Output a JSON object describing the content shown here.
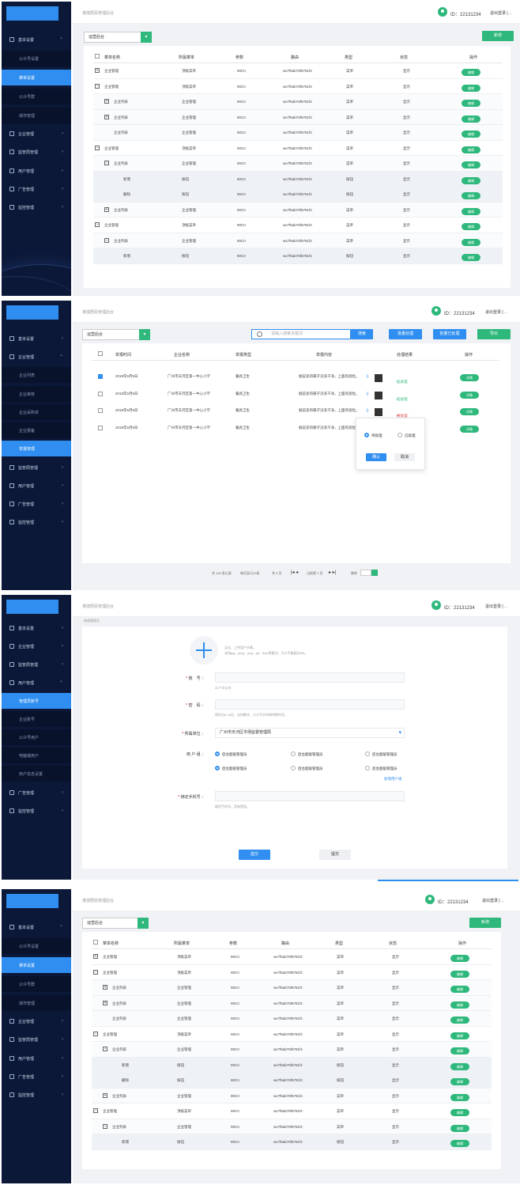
{
  "common": {
    "app_title": "港澳居民管理后台",
    "user_id": "ID：22131234",
    "logout": "退出登录",
    "logout_icon": "logout-icon"
  },
  "menu_list": {
    "sidebar": {
      "basic_settings": "基本设置",
      "sub": [
        "公众号设置",
        "菜单设置",
        "公众号群",
        "城市管理"
      ],
      "enterprise": "企业管理",
      "supervision": "监管局管理",
      "users": "用户管理",
      "ads": "广告管理",
      "monitoring": "监控管理"
    },
    "select_value": "运营后台",
    "add_button": "新增",
    "headers": [
      "菜单名称",
      "所属菜单",
      "参数",
      "路由",
      "类型",
      "状态",
      "操作"
    ],
    "rows": [
      {
        "name": "企业管理",
        "parent": "顶级菜单",
        "param": "90CII",
        "route": "wx7f6ab76f6781f4",
        "type": "菜单",
        "status": "显示",
        "op": "编辑",
        "toggle": "+"
      },
      {
        "name": "企业管理",
        "parent": "顶级菜单",
        "param": "90CII",
        "route": "wx7f6ab76f6781f4",
        "type": "菜单",
        "status": "显示",
        "op": "编辑",
        "toggle": "−"
      },
      {
        "name": "企业列表",
        "parent": "企业管理",
        "param": "90CII",
        "route": "wx7f6ab76f6781f4",
        "type": "菜单",
        "status": "显示",
        "op": "编辑",
        "toggle": "+"
      },
      {
        "name": "企业列表",
        "parent": "企业管理",
        "param": "90CII",
        "route": "wx7f6ab76f6781f4",
        "type": "菜单",
        "status": "显示",
        "op": "编辑",
        "toggle": "+"
      },
      {
        "name": "企业列表",
        "parent": "企业管理",
        "param": "90CII",
        "route": "wx7f6ab76f6781f4",
        "type": "菜单",
        "status": "显示",
        "op": "编辑",
        "toggle": ""
      },
      {
        "name": "企业管理",
        "parent": "顶级菜单",
        "param": "90CII",
        "route": "wx7f6ab76f6781f4",
        "type": "菜单",
        "status": "显示",
        "op": "编辑",
        "toggle": "−"
      },
      {
        "name": "企业列表",
        "parent": "企业管理",
        "param": "90CII",
        "route": "wx7f6ab76f6781f4",
        "type": "菜单",
        "status": "显示",
        "op": "编辑",
        "toggle": "−"
      },
      {
        "name": "新增",
        "parent": "按钮",
        "param": "90CII",
        "route": "wx7f6ab76f6781f4",
        "type": "按钮",
        "status": "显示",
        "op": "编辑",
        "toggle": ""
      },
      {
        "name": "删除",
        "parent": "按钮",
        "param": "90CII",
        "route": "wx7f6ab76f6781f4",
        "type": "按钮",
        "status": "显示",
        "op": "编辑",
        "toggle": ""
      },
      {
        "name": "企业列表",
        "parent": "企业管理",
        "param": "90CII",
        "route": "wx7f6ab76f6781f4",
        "type": "菜单",
        "status": "显示",
        "op": "编辑",
        "toggle": "+"
      },
      {
        "name": "企业管理",
        "parent": "顶级菜单",
        "param": "90CII",
        "route": "wx7f6ab76f6781f4",
        "type": "菜单",
        "status": "显示",
        "op": "编辑",
        "toggle": "−"
      },
      {
        "name": "企业列表",
        "parent": "企业管理",
        "param": "90CII",
        "route": "wx7f6ab76f6781f4",
        "type": "菜单",
        "status": "显示",
        "op": "编辑",
        "toggle": "−"
      },
      {
        "name": "新增",
        "parent": "按钮",
        "param": "90CII",
        "route": "wx7f6ab76f6781f4",
        "type": "按钮",
        "status": "显示",
        "op": "编辑",
        "toggle": ""
      }
    ]
  },
  "reports": {
    "sidebar": {
      "basic_settings": "基本设置",
      "enterprise": "企业管理",
      "sub": [
        "企业列表",
        "企业审核",
        "企业采购单",
        "企业报备",
        "举报管理"
      ],
      "supervision": "监管局管理",
      "users": "用户管理",
      "ads": "广告管理",
      "monitoring": "监控管理"
    },
    "select_value": "运营后台",
    "search_placeholder": "请输入搜索关键词",
    "search_button": "搜索",
    "batch_process": "批量处理",
    "batch_done": "批量已处理",
    "export": "导出",
    "headers": [
      "举报时间",
      "企业名称",
      "举报类型",
      "举报内容",
      "处理结果",
      "操作"
    ],
    "rows": [
      {
        "time": "2019年5月9日",
        "company": "广州市天河区第一中心小学",
        "type": "餐具卫生",
        "content": "据说卖的碟子没洗干净，上面有饭粒。",
        "result": "已处理",
        "op": "详情",
        "checked": true
      },
      {
        "time": "2019年5月9日",
        "company": "广州市天河区第一中心小学",
        "type": "餐具卫生",
        "content": "据说卖的碟子没洗干净，上面有饭粒。",
        "result": "已处理",
        "op": "详情",
        "checked": false
      },
      {
        "time": "2019年5月9日",
        "company": "广州市天河区第一中心小学",
        "type": "餐具卫生",
        "content": "据说卖的碟子没洗干净，上面有饭粒。",
        "result": "待处理",
        "op": "详情",
        "checked": false
      },
      {
        "time": "2019年5月9日",
        "company": "广州市天河区第一中心小学",
        "type": "餐具卫生",
        "content": "据说卖的碟子没洗干净，上面有饭粒。",
        "result": "",
        "op": "详情",
        "checked": false
      }
    ],
    "popup": {
      "opt_pending": "待处理",
      "opt_done": "已处理",
      "confirm": "确认",
      "cancel": "取消"
    },
    "pager": {
      "total": "共 100 条记录",
      "per_page": "每页显示20条",
      "pages": "共 5 页",
      "current": "当前第 1 页",
      "jump": "跳转"
    }
  },
  "add_admin": {
    "sidebar": {
      "basic_settings": "基本设置",
      "enterprise": "企业管理",
      "supervision": "监管局管理",
      "users": "用户管理",
      "sub": [
        "管理员账号",
        "企业账号",
        "公众号用户",
        "电脑端用户",
        "用户信息设置"
      ],
      "ads": "广告管理",
      "monitoring": "监控管理"
    },
    "breadcrumb": "新增管理员",
    "upload_hint_1": "点击、上传用户头像。",
    "upload_hint_2": "支持jpg、jpeg、png、gif、bmp等格式，大小不能超过5M。",
    "account_label": "账　号",
    "account_hint": "20个字以内",
    "password_label": "密　码",
    "password_hint": "密码为6-16位，支持数字、大小写字母和特殊符号。",
    "unit_label": "所属单位",
    "unit_value": "广州市天河区市场监督管理局",
    "group_label": "用 户 组",
    "groups": [
      "后台超级管理员",
      "后台超级管理员",
      "后台超级管理员",
      "后台超级管理员",
      "后台超级管理员",
      "后台超级管理员"
    ],
    "add_group": "新增用户组",
    "phone_label": "绑定手机号",
    "phone_hint": "绑定手机号，用来登陆。",
    "submit": "提交",
    "submit2": "提交"
  }
}
